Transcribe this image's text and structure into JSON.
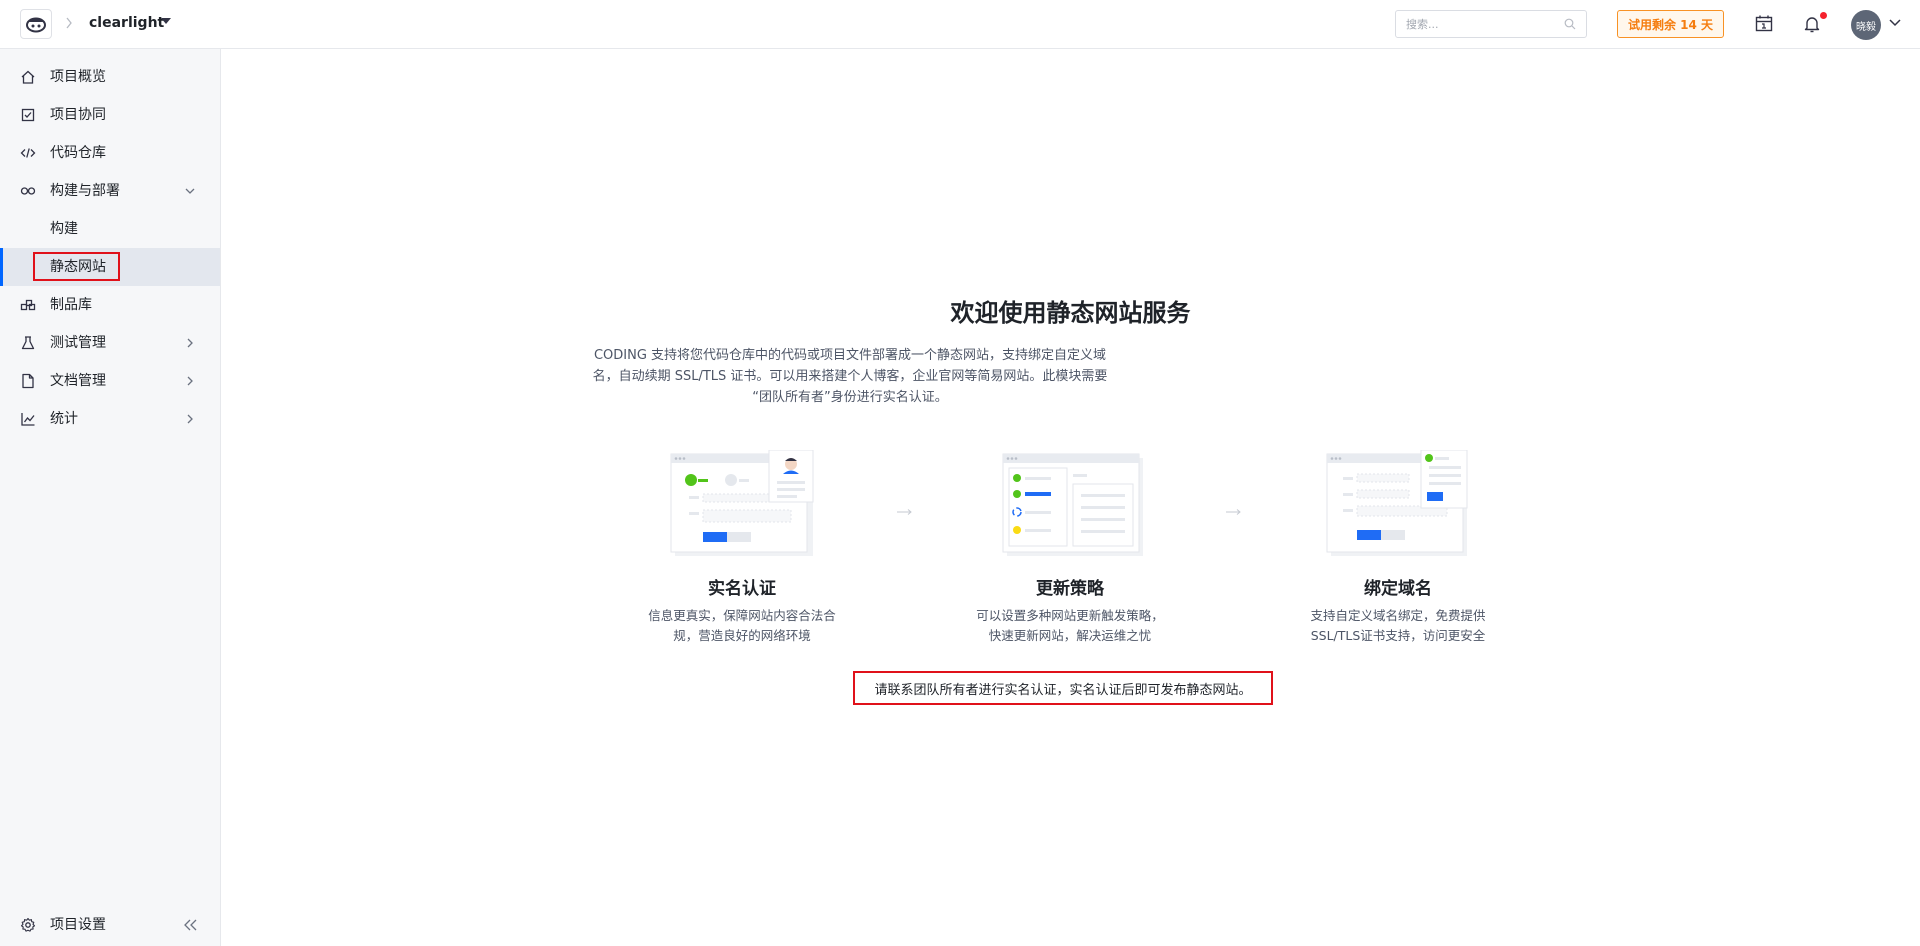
{
  "header": {
    "project_name": "clearlight",
    "search_placeholder": "搜索...",
    "trial_label": "试用剩余 14 天",
    "user_name": "晓毅"
  },
  "sidebar": {
    "items": [
      {
        "label": "项目概览",
        "icon": "home-icon"
      },
      {
        "label": "项目协同",
        "icon": "checkbox-icon"
      },
      {
        "label": "代码仓库",
        "icon": "code-icon"
      },
      {
        "label": "构建与部署",
        "icon": "infinity-icon",
        "expanded": true
      },
      {
        "label": "构建"
      },
      {
        "label": "静态网站",
        "active": true
      },
      {
        "label": "制品库",
        "icon": "package-icon"
      },
      {
        "label": "测试管理",
        "icon": "flask-icon"
      },
      {
        "label": "文档管理",
        "icon": "document-icon"
      },
      {
        "label": "统计",
        "icon": "chart-icon"
      }
    ],
    "settings_label": "项目设置"
  },
  "main": {
    "title": "欢迎使用静态网站服务",
    "intro_line1": "CODING 支持将您代码仓库中的代码或项目文件部署成一个静态网站，支持绑定自定义域",
    "intro_line2": "名，自动续期 SSL/TLS 证书。可以用来搭建个人博客，企业官网等简易网站。此模块需要",
    "intro_line3": "“团队所有者”身份进行实名认证。",
    "features": [
      {
        "title": "实名认证",
        "desc1": "信息更真实，保障网站内容合法合",
        "desc2": "规，营造良好的网络环境"
      },
      {
        "title": "更新策略",
        "desc1": "可以设置多种网站更新触发策略，",
        "desc2": "快速更新网站，解决运维之忧"
      },
      {
        "title": "绑定域名",
        "desc1": "支持自定义域名绑定，免费提供",
        "desc2": "SSL/TLS证书支持，访问更安全"
      }
    ],
    "notice": "请联系团队所有者进行实名认证，实名认证后即可发布静态网站。"
  },
  "colors": {
    "accent": "#0066ff",
    "trial": "#f57d0f",
    "highlight_border": "#e0111a",
    "sidebar_bg": "#f6f7f9",
    "success": "#52c41a"
  }
}
